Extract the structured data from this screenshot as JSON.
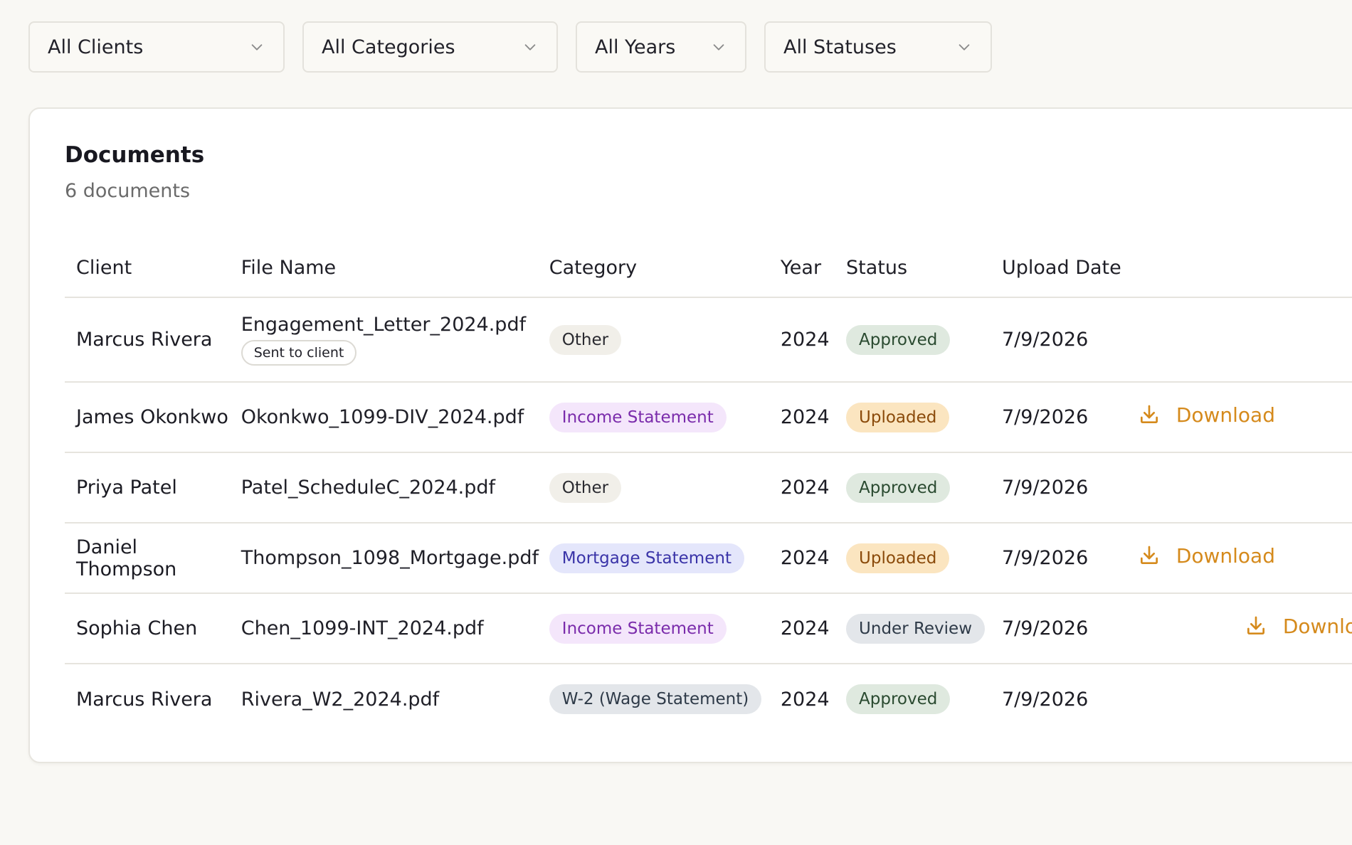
{
  "filters": [
    {
      "value": "All Clients",
      "width": 360
    },
    {
      "value": "All Categories",
      "width": 359
    },
    {
      "value": "All Years",
      "width": 240
    },
    {
      "value": "All Statuses",
      "width": 320
    }
  ],
  "card": {
    "title": "Documents",
    "subtitle": "6 documents"
  },
  "table": {
    "headers": {
      "client": "Client",
      "file": "File Name",
      "category": "Category",
      "year": "Year",
      "status": "Status",
      "date": "Upload Date"
    },
    "rows": [
      {
        "client": "Marcus Rivera",
        "file": "Engagement_Letter_2024.pdf",
        "badge": "Sent to client",
        "category": "Other",
        "category_style": "other",
        "year": "2024",
        "status": "Approved",
        "status_style": "approved",
        "date": "7/9/2026",
        "action": ""
      },
      {
        "client": "James Okonkwo",
        "file": "Okonkwo_1099-DIV_2024.pdf",
        "badge": "",
        "category": "Income Statement",
        "category_style": "income",
        "year": "2024",
        "status": "Uploaded",
        "status_style": "uploaded",
        "date": "7/9/2026",
        "action": "Download"
      },
      {
        "client": "Priya Patel",
        "file": "Patel_ScheduleC_2024.pdf",
        "badge": "",
        "category": "Other",
        "category_style": "other",
        "year": "2024",
        "status": "Approved",
        "status_style": "approved",
        "date": "7/9/2026",
        "action": ""
      },
      {
        "client": "Daniel Thompson",
        "file": "Thompson_1098_Mortgage.pdf",
        "badge": "",
        "category": "Mortgage Statement",
        "category_style": "mortgage",
        "year": "2024",
        "status": "Uploaded",
        "status_style": "uploaded",
        "date": "7/9/2026",
        "action": "Download"
      },
      {
        "client": "Sophia Chen",
        "file": "Chen_1099-INT_2024.pdf",
        "badge": "",
        "category": "Income Statement",
        "category_style": "income",
        "year": "2024",
        "status": "Under Review",
        "status_style": "review",
        "date": "7/9/2026",
        "action": "Download"
      },
      {
        "client": "Marcus Rivera",
        "file": "Rivera_W2_2024.pdf",
        "badge": "",
        "category": "W-2 (Wage Statement)",
        "category_style": "w2",
        "year": "2024",
        "status": "Approved",
        "status_style": "approved",
        "date": "7/9/2026",
        "action": ""
      }
    ]
  },
  "colors": {
    "accent": "#d58a1c",
    "other_bg": "#f1efe9",
    "other_fg": "#2a2a30",
    "income_bg": "#f4e6fb",
    "income_fg": "#7a2bab",
    "mortgage_bg": "#e4e6fb",
    "mortgage_fg": "#3a34a8",
    "w2_bg": "#e3e6ea",
    "w2_fg": "#2e3a48",
    "approved_bg": "#dfe9df",
    "approved_fg": "#2a4a30",
    "uploaded_bg": "#fbe5c0",
    "uploaded_fg": "#8a4a0a",
    "review_bg": "#e3e6ea",
    "review_fg": "#2e3a48"
  },
  "icons": {
    "filter_chevron": "chevron-down-icon",
    "download": "download-icon"
  }
}
